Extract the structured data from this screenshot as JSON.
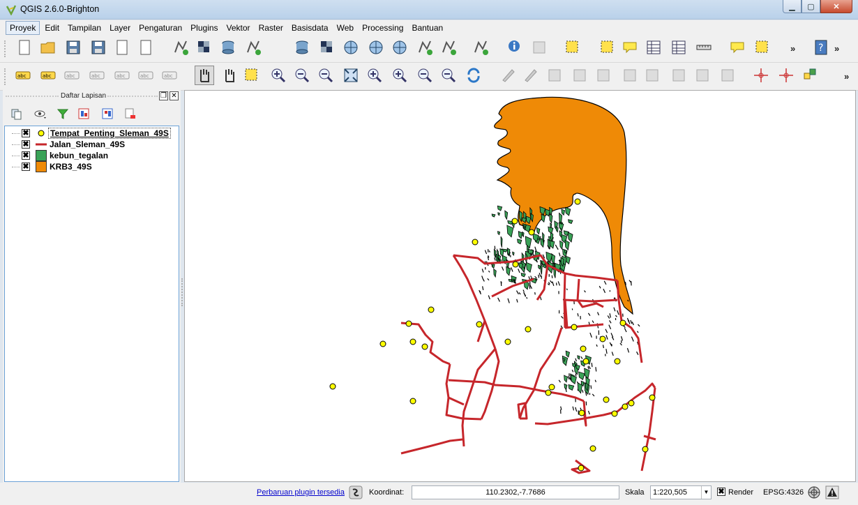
{
  "window": {
    "title": "QGIS 2.6.0-Brighton",
    "buttons": {
      "minimize": "▁",
      "maximize": "▢",
      "close": "✕"
    }
  },
  "menubar": {
    "items": [
      "Proyek",
      "Edit",
      "Tampilan",
      "Layer",
      "Pengaturan",
      "Plugins",
      "Vektor",
      "Raster",
      "Basisdata",
      "Web",
      "Processing",
      "Bantuan"
    ],
    "active_index": 0
  },
  "toolbar": {
    "overflow_symbol": "»",
    "row1_icons": [
      "new-project-icon",
      "open-project-icon",
      "save-project-icon",
      "save-as-icon",
      "new-print-composer-icon",
      "composer-manager-icon",
      "add-vector-layer-icon",
      "add-raster-layer-icon",
      "add-postgis-layer-icon",
      "add-spatialite-layer-icon",
      "add-mssql-layer-icon",
      "add-oracle-layer-icon",
      "add-wms-layer-icon",
      "add-wcs-layer-icon",
      "add-wfs-layer-icon",
      "add-delimited-text-icon",
      "new-shapefile-icon",
      "temporary-layer-icon",
      "identify-icon",
      "action-icon",
      "select-feature-icon",
      "deselect-icon",
      "expression-select-icon",
      "attribute-table-icon",
      "field-calculator-icon",
      "measure-icon",
      "map-tips-icon",
      "new-bookmark-icon",
      "help-icon"
    ],
    "row2_icons": [
      "label-toolbar-icon",
      "label-highlight-icon",
      "label-pin-icon",
      "label-show-hide-icon",
      "label-move-icon",
      "label-rotate-icon",
      "label-change-icon",
      "touch-zoom-icon",
      "pan-icon",
      "pan-to-selection-icon",
      "zoom-in-icon",
      "zoom-out-icon",
      "zoom-native-icon",
      "zoom-full-icon",
      "zoom-to-selection-icon",
      "zoom-to-layer-icon",
      "zoom-last-icon",
      "zoom-next-icon",
      "refresh-icon",
      "current-edits-icon",
      "toggle-editing-icon",
      "save-edits-icon",
      "add-feature-icon",
      "move-feature-icon",
      "node-tool-icon",
      "delete-selected-icon",
      "cut-features-icon",
      "copy-features-icon",
      "paste-features-icon",
      "crosshair-icon",
      "gps-icon",
      "plugin-icon"
    ]
  },
  "layers_panel": {
    "title": "Daftar Lapisan",
    "float_button": "❐",
    "close_button": "✕",
    "tool_icons": [
      "add-group-icon",
      "manage-visibility-icon",
      "filter-legend-icon",
      "expand-all-icon",
      "collapse-all-icon",
      "remove-layer-icon"
    ],
    "layers": [
      {
        "name": "Tempat_Penting_Sleman_49S",
        "checked": true,
        "symbol": "point",
        "color": "#ffff00",
        "selected": true
      },
      {
        "name": "Jalan_Sleman_49S",
        "checked": true,
        "symbol": "line",
        "color": "#c6262b",
        "selected": false
      },
      {
        "name": "kebun_tegalan",
        "checked": true,
        "symbol": "polygon",
        "color": "#3aa257",
        "selected": false
      },
      {
        "name": "KRB3_49S",
        "checked": true,
        "symbol": "polygon",
        "color": "#ef8a06",
        "selected": false
      }
    ],
    "check_mark": "✖"
  },
  "map": {
    "colors": {
      "krb3": "#ef8a06",
      "kebun": "#3aa257",
      "roads": "#c6262b",
      "points": "#ffff00"
    }
  },
  "statusbar": {
    "plugin_update_link": "Perbaruan plugin tersedia",
    "coordinate_label": "Koordinat:",
    "coordinate_value": "110.2302,-7.7686",
    "scale_label": "Skala",
    "scale_value": "1:220,505",
    "scale_dropdown": "▼",
    "render_label": "Render",
    "render_check": "✖",
    "crs_label": "EPSG:4326"
  }
}
